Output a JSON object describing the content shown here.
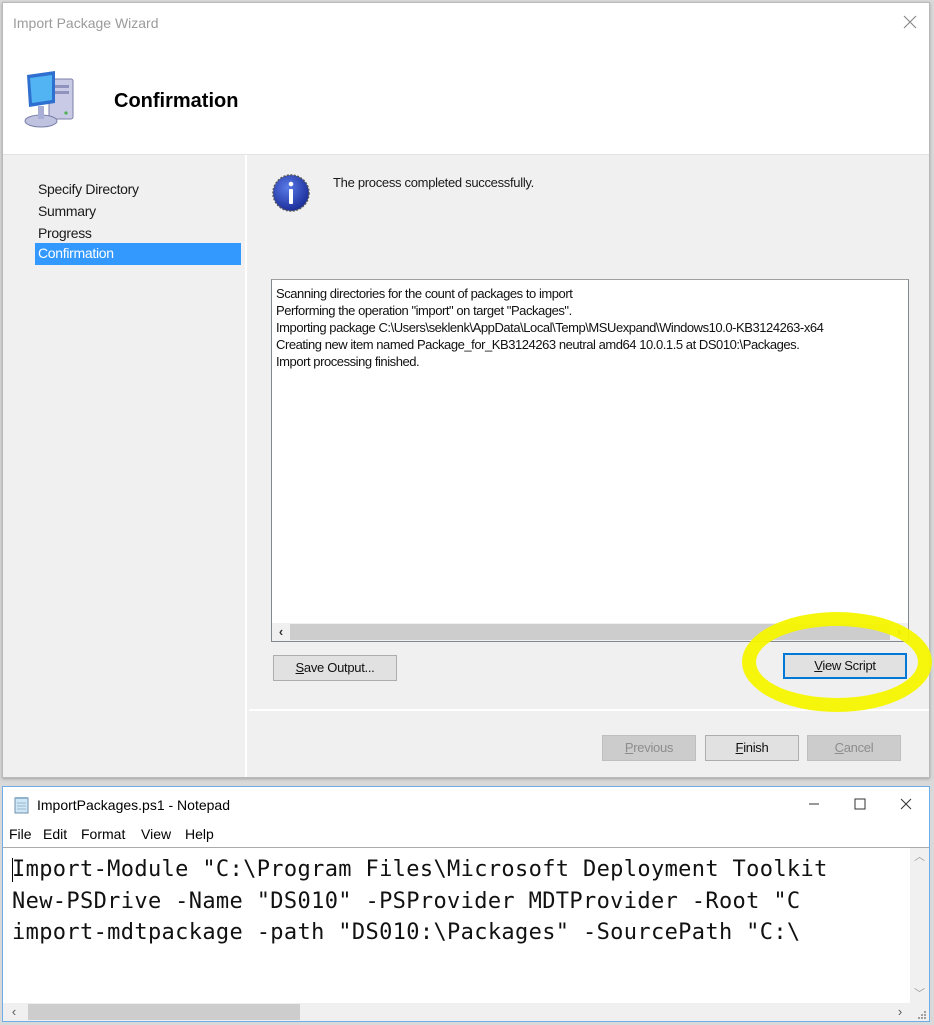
{
  "wizard": {
    "title": "Import Package Wizard",
    "heading": "Confirmation",
    "header_icon": "computer-icon",
    "close_icon": "close-icon",
    "nav_items": [
      {
        "label": "Specify Directory",
        "active": false
      },
      {
        "label": "Summary",
        "active": false
      },
      {
        "label": "Progress",
        "active": false
      },
      {
        "label": "Confirmation",
        "active": true
      }
    ],
    "status_icon": "info-icon",
    "status_text": "The process completed successfully.",
    "output_lines": [
      "Scanning directories for the count of packages to import",
      "Performing the operation \"import\" on target \"Packages\".",
      "Importing package C:\\Users\\seklenk\\AppData\\Local\\Temp\\MSUexpand\\Windows10.0-KB3124263-x64",
      "Creating new item named Package_for_KB3124263 neutral amd64 10.0.1.5 at DS010:\\Packages.",
      "Import processing finished."
    ],
    "buttons": {
      "save_output": {
        "mnemonic": "S",
        "rest": "ave Output..."
      },
      "view_script": {
        "mnemonic": "V",
        "rest": "iew Script"
      },
      "previous": {
        "mnemonic": "P",
        "rest": "revious",
        "enabled": false
      },
      "finish": {
        "mnemonic": "F",
        "rest": "inish",
        "enabled": true
      },
      "cancel": {
        "mnemonic": "C",
        "rest": "ancel",
        "enabled": false
      }
    },
    "highlight_color": "#f5f500",
    "selection_color": "#3399ff"
  },
  "notepad": {
    "title": "ImportPackages.ps1 - Notepad",
    "menu": [
      "File",
      "Edit",
      "Format",
      "View",
      "Help"
    ],
    "lines": [
      "Import-Module \"C:\\Program Files\\Microsoft Deployment Toolkit",
      "New-PSDrive -Name \"DS010\" -PSProvider MDTProvider -Root \"C",
      "import-mdtpackage -path \"DS010:\\Packages\" -SourcePath \"C:\\"
    ]
  }
}
